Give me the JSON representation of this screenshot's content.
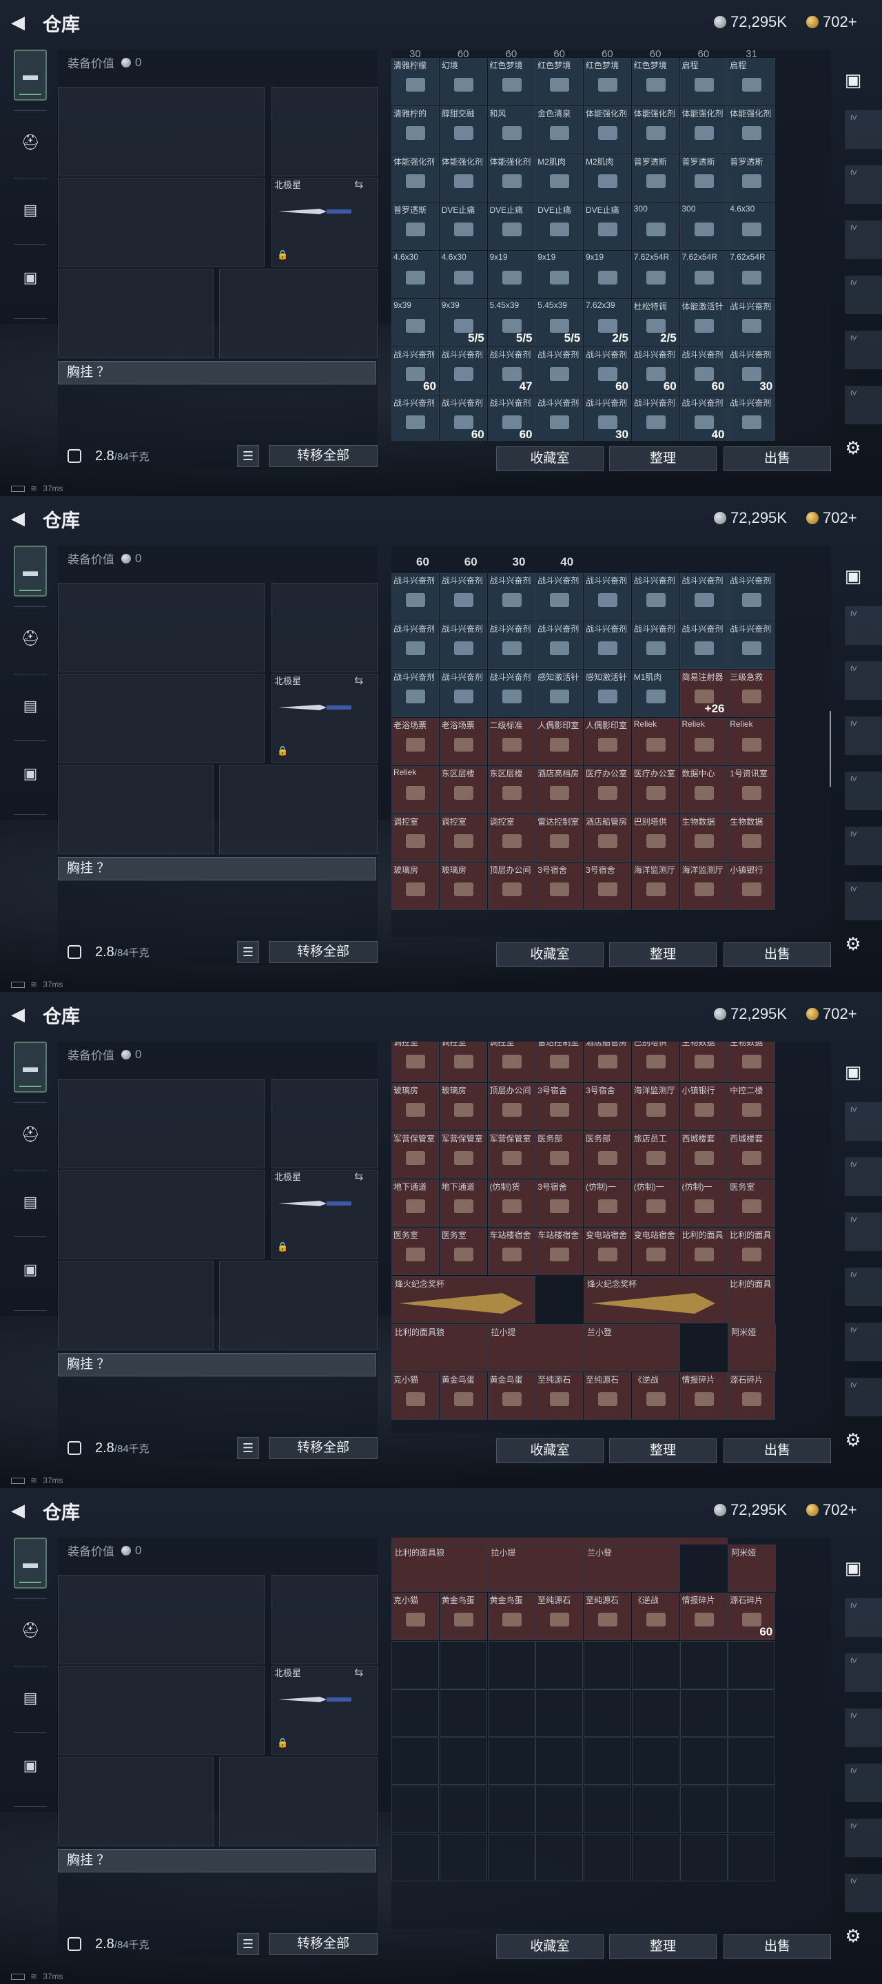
{
  "header": {
    "title": "仓库",
    "silver": "72,295K",
    "gold": "702+"
  },
  "equipment": {
    "value_label": "装备价值",
    "value": "0",
    "melee_label": "北极星",
    "chest_label": "胸挂 ？",
    "weight": "2.8",
    "weight_max": "/84千克",
    "transfer_all": "转移全部"
  },
  "buttons": {
    "collection": "收藏室",
    "sort": "整理",
    "sell": "出售"
  },
  "status": {
    "ping": "37ms"
  },
  "rail_side": [
    "IV",
    "IV",
    "IV",
    "IV",
    "IV",
    "IV"
  ],
  "colors": {
    "accent_green": "#6fb18c",
    "item_blue": "#243546",
    "item_red": "#4a2a2c"
  },
  "screens": [
    {
      "cells": [
        [
          "30",
          "60",
          "60",
          "60",
          "60",
          "60",
          "60",
          "31"
        ],
        [
          "清雅柠檬",
          "幻境",
          "红色梦境",
          "红色梦境",
          "红色梦境",
          "红色梦境",
          "启程",
          "启程"
        ],
        [
          "清雅柠的",
          "醇甜交融",
          "和风",
          "金色清泉",
          "体能强化剂",
          "体能强化剂",
          "体能强化剂",
          "体能强化剂"
        ],
        [
          "体能强化剂",
          "体能强化剂",
          "体能强化剂",
          "M2肌肉",
          "M2肌肉",
          "普罗透斯",
          "普罗透斯",
          "普罗透斯"
        ],
        [
          "普罗透斯",
          "DVE止痛",
          "DVE止痛",
          "DVE止痛",
          "DVE止痛",
          "300",
          "300",
          "4.6x30"
        ],
        [
          "4.6x30",
          "4.6x30",
          "9x19",
          "9x19",
          "9x19",
          "7.62x54R",
          "7.62x54R",
          "7.62x54R"
        ],
        [
          "9x39",
          "9x39",
          "5.45x39",
          "5.45x39",
          "7.62x39",
          "杜松特调",
          "体能激活针",
          "战斗兴奋剂"
        ],
        [
          "战斗兴奋剂",
          "战斗兴奋剂",
          "战斗兴奋剂",
          "战斗兴奋剂",
          "战斗兴奋剂",
          "战斗兴奋剂",
          "战斗兴奋剂",
          "战斗兴奋剂"
        ],
        [
          "战斗兴奋剂",
          "战斗兴奋剂",
          "战斗兴奋剂",
          "战斗兴奋剂",
          "战斗兴奋剂",
          "战斗兴奋剂",
          "战斗兴奋剂",
          "战斗兴奋剂"
        ]
      ],
      "counts": [
        [
          "",
          "",
          "",
          "",
          "",
          "",
          "",
          ""
        ],
        [
          "",
          "",
          "",
          "",
          "",
          "",
          "",
          ""
        ],
        [
          "",
          "",
          "",
          "",
          "",
          "",
          "",
          ""
        ],
        [
          "",
          "5/5",
          "5/5",
          "5/5",
          "2/5",
          "2/5",
          "",
          ""
        ],
        [
          "60",
          "",
          "47",
          "",
          "60",
          "60",
          "60",
          "30"
        ],
        [
          "",
          "60",
          "60",
          "",
          "30",
          "",
          "40",
          ""
        ]
      ]
    },
    {
      "cells": [
        [
          "60",
          "60",
          "30",
          "40",
          "",
          "",
          "",
          ""
        ],
        [
          "战斗兴奋剂",
          "战斗兴奋剂",
          "战斗兴奋剂",
          "战斗兴奋剂",
          "战斗兴奋剂",
          "战斗兴奋剂",
          "战斗兴奋剂",
          "战斗兴奋剂"
        ],
        [
          "战斗兴奋剂",
          "战斗兴奋剂",
          "战斗兴奋剂",
          "战斗兴奋剂",
          "战斗兴奋剂",
          "战斗兴奋剂",
          "战斗兴奋剂",
          "战斗兴奋剂"
        ],
        [
          "战斗兴奋剂",
          "战斗兴奋剂",
          "战斗兴奋剂",
          "感知激活针",
          "感知激活针",
          "M1肌肉",
          "简易注射器",
          "三级急救"
        ],
        [
          "老浴场票",
          "老浴场票",
          "二级标准",
          "人偶影印室",
          "人偶影印室",
          "Reliek",
          "Reliek",
          "Reliek"
        ],
        [
          "Reliek",
          "东区层楼",
          "东区层楼",
          "酒店高档房",
          "医疗办公室",
          "医疗办公室",
          "数据中心",
          "1号资讯室"
        ],
        [
          "调控室",
          "调控室",
          "调控室",
          "雷达控制室",
          "酒店船管房",
          "巴别塔供",
          "生物数据",
          "生物数据"
        ],
        [
          "玻璃房",
          "玻璃房",
          "顶层办公间",
          "3号宿舍",
          "3号宿舍",
          "海洋监测厅",
          "海洋监测厅",
          "小镇银行"
        ]
      ],
      "counts": [
        "",
        "",
        "",
        "",
        "",
        "",
        "+26",
        ""
      ]
    },
    {
      "cells": [
        [
          "调控室",
          "调控室",
          "调控室",
          "雷达控制室",
          "酒店船管房",
          "巴别塔供",
          "生物数据",
          "生物数据"
        ],
        [
          "玻璃房",
          "玻璃房",
          "顶层办公间",
          "3号宿舍",
          "3号宿舍",
          "海洋监测厅",
          "小镇银行",
          "中控二楼"
        ],
        [
          "军营保管室",
          "军营保管室",
          "军营保管室",
          "医务部",
          "医务部",
          "旅店员工",
          "西城楼套",
          "西城楼套"
        ],
        [
          "地下通道",
          "地下通道",
          "(仿制)货",
          "3号宿舍",
          "(仿制)一",
          "(仿制)一",
          "(仿制)一",
          "医务室"
        ],
        [
          "医务室",
          "医务室",
          "车站楼宿舍",
          "车站楼宿舍",
          "变电站宿舍",
          "变电站宿舍",
          "比利的面具",
          "比利的面具"
        ]
      ],
      "wide": [
        "烽火纪念奖杯",
        "烽火纪念奖杯"
      ],
      "tall": [
        "比利的面具"
      ],
      "row6": [
        "比利的面具狼",
        "拉小提",
        "兰小登",
        "阿米娅"
      ],
      "row7": [
        "克小猫",
        "黄金鸟蛋",
        "黄金鸟蛋",
        "至纯源石",
        "至纯源石",
        "《逆战",
        "情报碎片",
        "源石碎片"
      ]
    },
    {
      "row6": [
        "比利的面具狼",
        "拉小提",
        "兰小登",
        "阿米娅"
      ],
      "row7": [
        "克小猫",
        "黄金鸟蛋",
        "黄金鸟蛋",
        "至纯源石",
        "至纯源石",
        "《逆战",
        "情报碎片",
        "源石碎片"
      ],
      "last_count": "60"
    }
  ]
}
